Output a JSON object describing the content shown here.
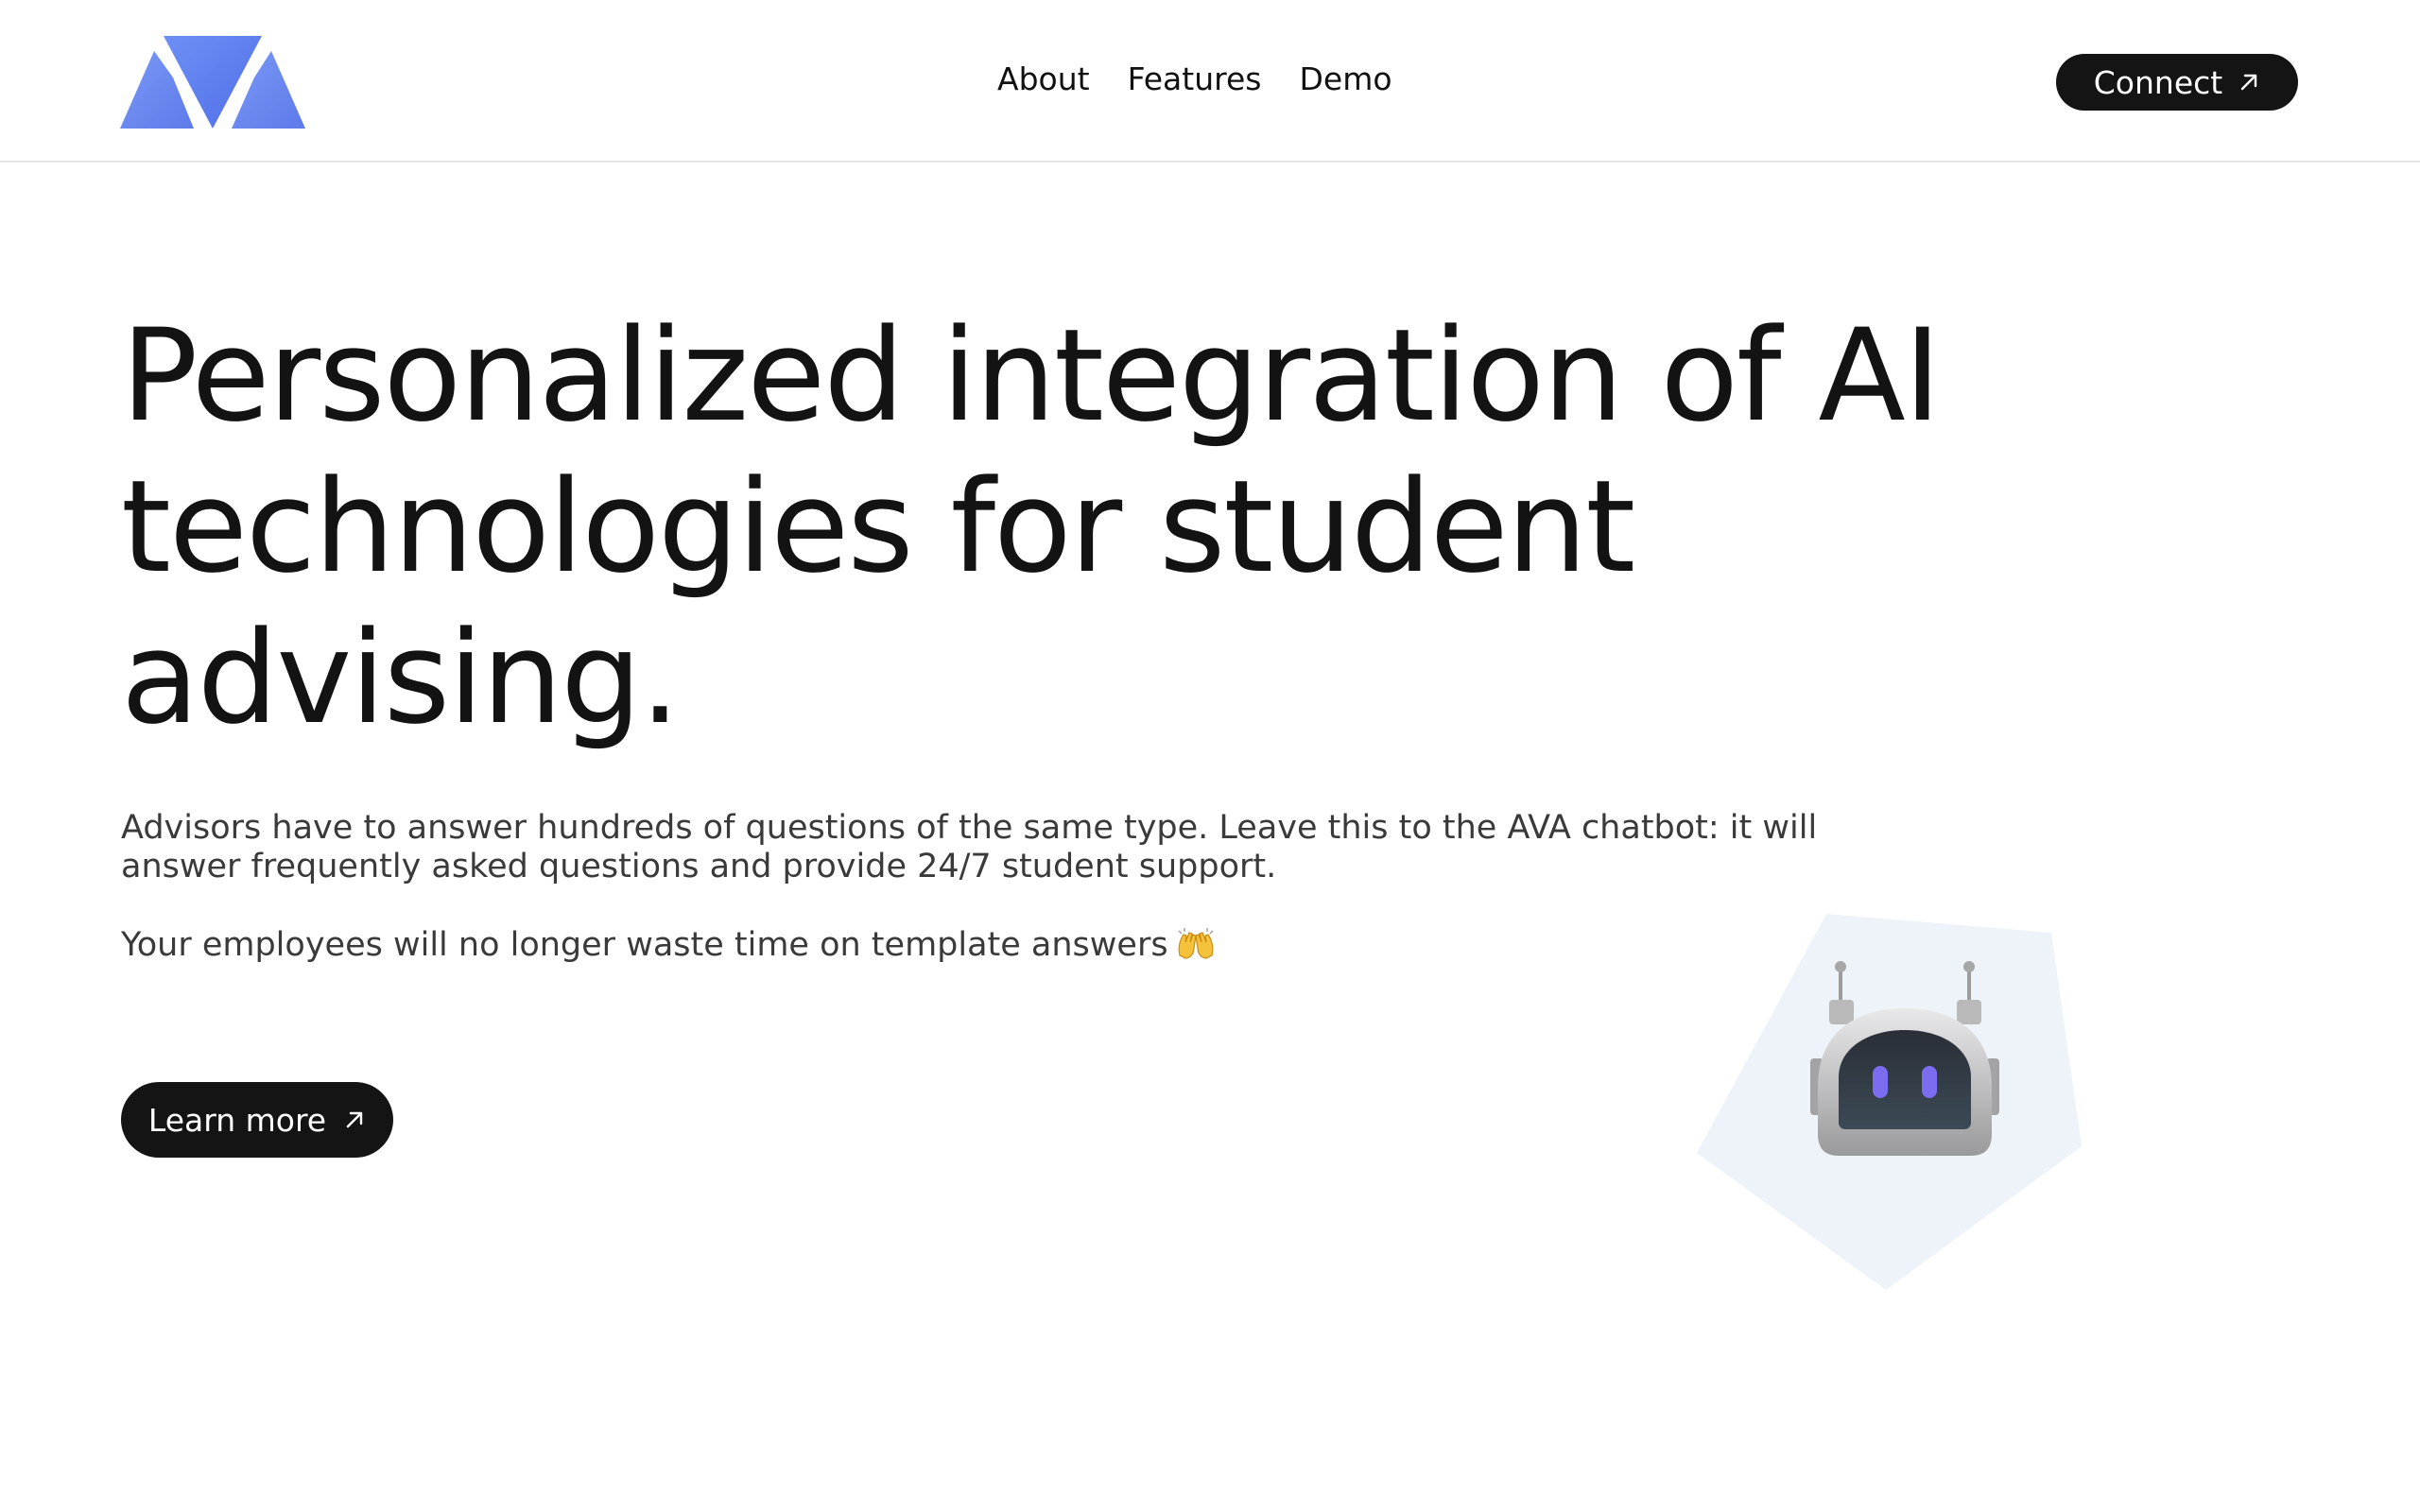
{
  "header": {
    "logo_name": "ava-logo",
    "nav": [
      {
        "label": "About"
      },
      {
        "label": "Features"
      },
      {
        "label": "Demo"
      }
    ],
    "connect_label": "Connect",
    "connect_icon": "arrow-up-right-icon"
  },
  "hero": {
    "headline": "Personalized integration of AI technologies for student advising.",
    "description": "Advisors have to answer hundreds of questions of the same type. Leave this to the AVA chatbot: it will answer frequently asked questions and provide 24/7 student support.",
    "description2": "Your employees will no longer waste time on template answers",
    "emoji_icon": "raised-hands-emoji-icon",
    "learn_more_label": "Learn more",
    "learn_more_icon": "arrow-up-right-icon",
    "illustration": "robot-head-icon"
  },
  "colors": {
    "logo_blue": "#5b7ff0",
    "button_bg": "#141414",
    "pentagon_bg": "#eef3f9",
    "robot_eye": "#7b6cf0"
  }
}
